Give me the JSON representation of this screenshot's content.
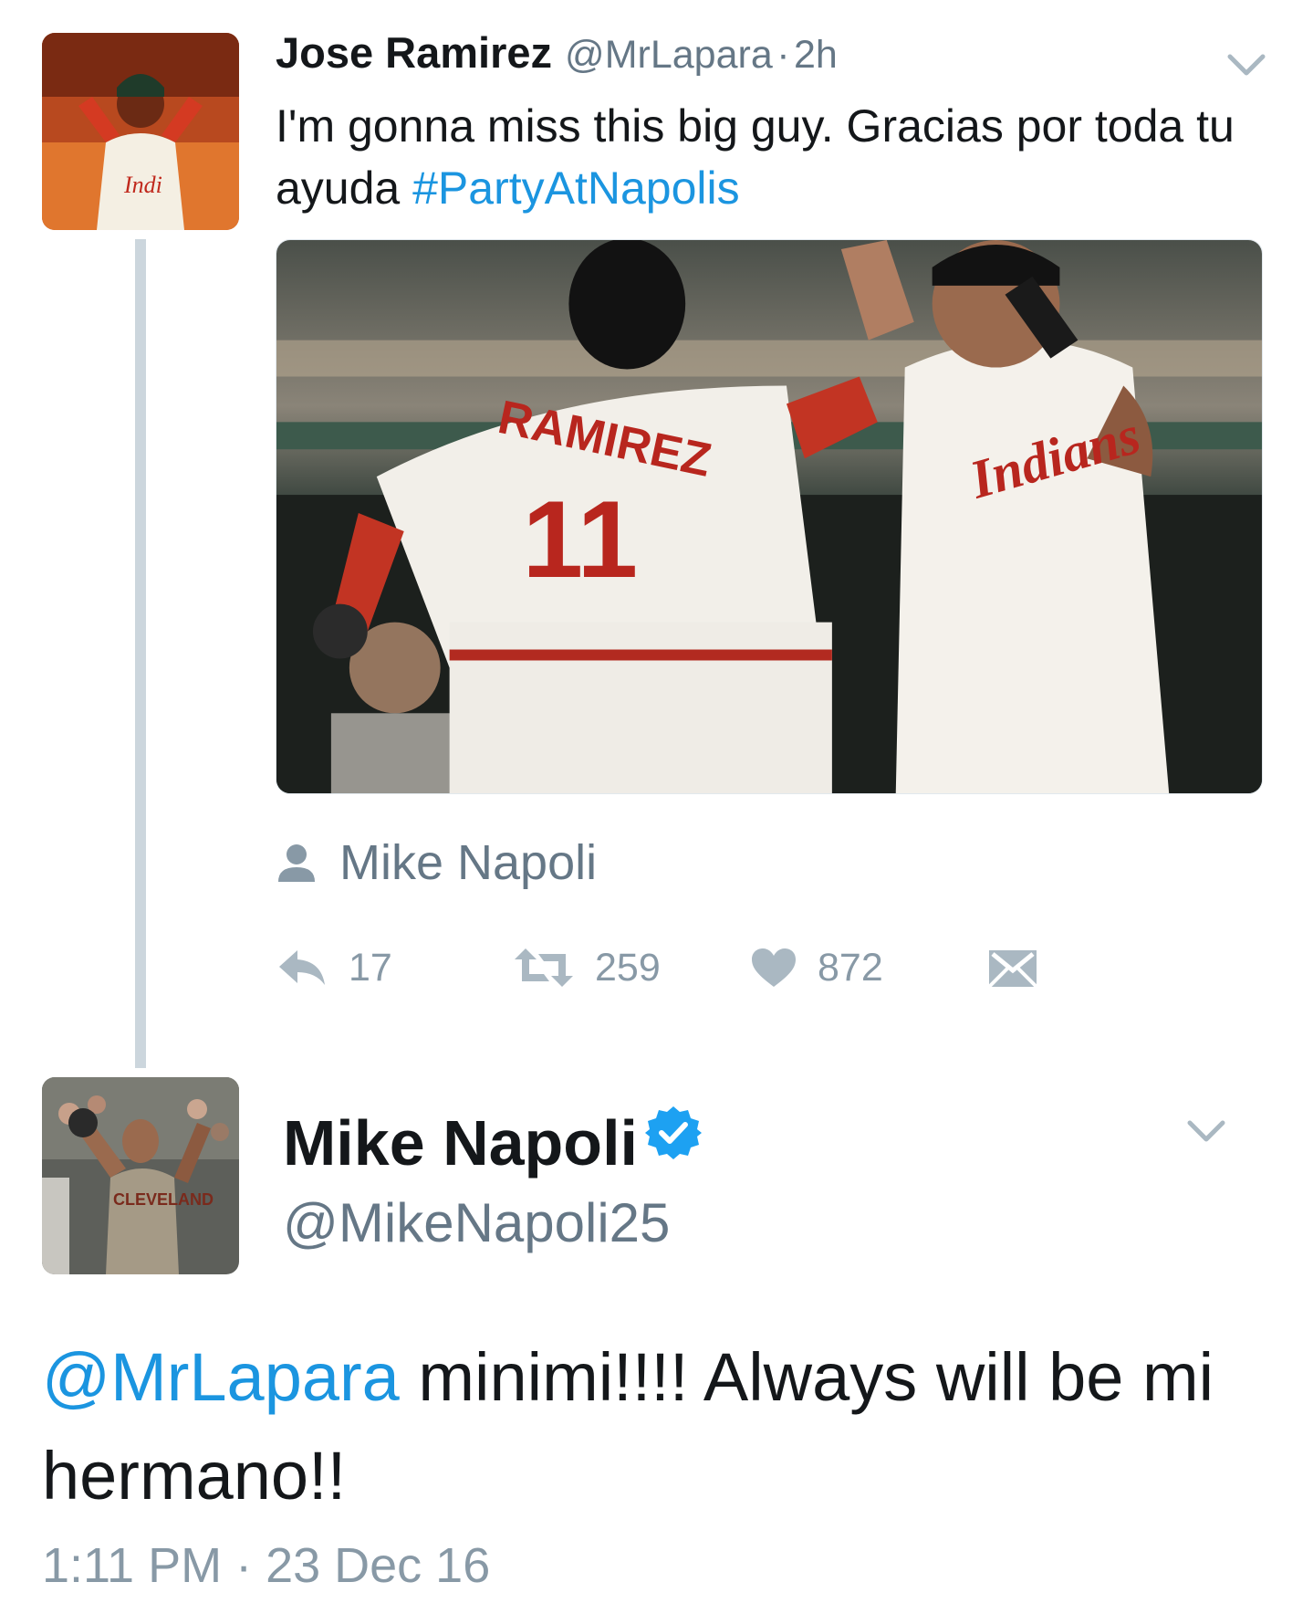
{
  "tweet_original": {
    "author_name": "Jose Ramirez",
    "author_handle": "@MrLapara",
    "separator": "·",
    "time": "2h",
    "text": "I'm gonna miss this big guy. Gracias por toda tu ayuda ",
    "hashtag": "#PartyAtNapolis",
    "tagged_user": "Mike Napoli",
    "reply_count": "17",
    "retweet_count": "259",
    "like_count": "872"
  },
  "tweet_reply": {
    "author_name": "Mike Napoli",
    "author_handle": "@MikeNapoli25",
    "mention": "@MrLapara",
    "text": " minimi!!!! Always will be mi hermano!!",
    "timestamp": "1:11 PM · 23 Dec 16"
  },
  "icons": {
    "menu_chevron": "chevron-down-icon",
    "tag": "person-icon",
    "reply": "reply-icon",
    "retweet": "retweet-icon",
    "like": "heart-icon",
    "dm": "envelope-icon",
    "verified": "verified-badge-icon"
  },
  "colors": {
    "link_blue": "#1b95e0",
    "secondary_text": "#657786",
    "action_gray": "#aab8c2",
    "verified_blue": "#1da1f2",
    "thread_line": "#ccd6dd"
  }
}
